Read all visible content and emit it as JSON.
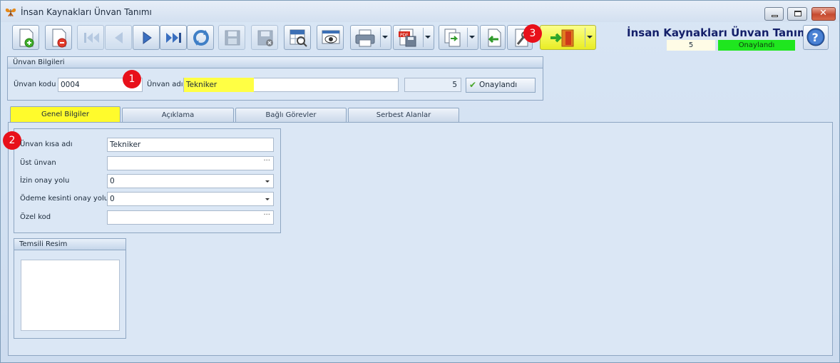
{
  "window": {
    "title": "İnsan Kaynakları Ünvan Tanımı"
  },
  "toolbar": {
    "buttons": [
      {
        "name": "new-record",
        "icon": "new-document-icon"
      },
      {
        "name": "delete-record",
        "icon": "delete-document-icon"
      },
      {
        "name": "first-record",
        "icon": "first-icon"
      },
      {
        "name": "previous-record",
        "icon": "previous-icon"
      },
      {
        "name": "next-record",
        "icon": "next-icon"
      },
      {
        "name": "last-record",
        "icon": "last-icon"
      },
      {
        "name": "refresh",
        "icon": "refresh-icon"
      },
      {
        "name": "save",
        "icon": "save-icon"
      },
      {
        "name": "cancel-changes",
        "icon": "save-cancel-icon"
      },
      {
        "name": "list-view",
        "icon": "grid-search-icon"
      },
      {
        "name": "preview",
        "icon": "eye-icon"
      },
      {
        "name": "print",
        "icon": "printer-icon"
      },
      {
        "name": "export-pdf",
        "icon": "pdf-icon"
      },
      {
        "name": "copy",
        "icon": "copy-icon"
      },
      {
        "name": "import",
        "icon": "import-icon"
      },
      {
        "name": "tools",
        "icon": "wrench-icon"
      },
      {
        "name": "exit",
        "icon": "door-exit-icon"
      }
    ]
  },
  "header": {
    "title": "İnsan Kaynakları Ünvan Tanımı",
    "record_no": "5",
    "status": "Onaylandı",
    "status_color": "#1fe61f"
  },
  "unvan_bilgileri": {
    "group_title": "Ünvan Bilgileri",
    "code_label": "Ünvan kodu",
    "code_value": "0004",
    "name_label": "Ünvan adı",
    "name_value": "Tekniker",
    "record_no": "5",
    "approve_label": "Onaylandı"
  },
  "tabs": [
    {
      "label": "Genel Bilgiler",
      "active": true
    },
    {
      "label": "Açıklama",
      "active": false
    },
    {
      "label": "Bağlı Görevler",
      "active": false
    },
    {
      "label": "Serbest Alanlar",
      "active": false
    }
  ],
  "genel": {
    "short_name_label": "Ünvan kısa adı",
    "short_name_value": "Tekniker",
    "parent_label": "Üst ünvan",
    "parent_value": "",
    "leave_label": "İzin onay yolu",
    "leave_value": "0",
    "payment_label": "Ödeme kesinti onay yolu",
    "payment_value": "0",
    "special_label": "Özel kod",
    "special_value": ""
  },
  "image_group": {
    "title": "Temsili Resim"
  },
  "annotations": {
    "badge1": "1",
    "badge2": "2",
    "badge3": "3"
  },
  "colors": {
    "highlight": "#fffb2c",
    "badge": "#e8101a",
    "title_blue": "#14206a"
  }
}
